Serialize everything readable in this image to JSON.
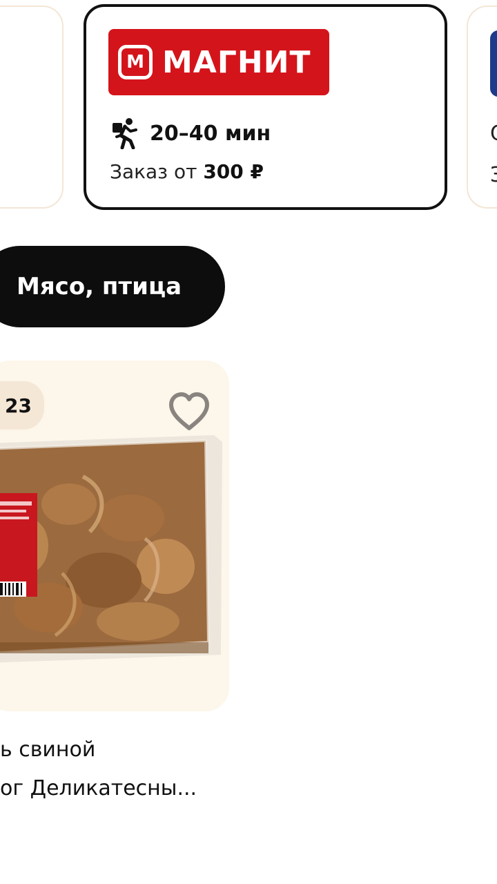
{
  "stores": {
    "main": {
      "logo_text": "МАГНИТ",
      "logo_mark": "М",
      "delivery_time": "20–40 мин",
      "min_order_prefix": "Заказ от",
      "min_order_price": "300 ₽",
      "brand_color": "#d4141b"
    },
    "right": {
      "text1": "С",
      "text2": "З",
      "brand_color": "#1f3a8a"
    }
  },
  "category": {
    "label": "Мясо, птица"
  },
  "product": {
    "badge": "23",
    "name_line1": "ь свиной",
    "name_line2": "ог Деликатесны..."
  }
}
